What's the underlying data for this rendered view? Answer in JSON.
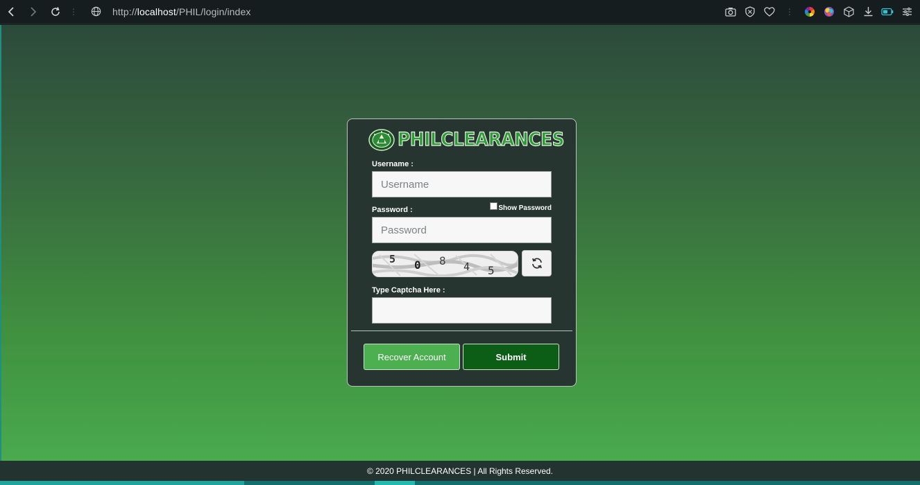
{
  "browser": {
    "url_host": "localhost",
    "url_prefix": "http://",
    "url_path": "/PHIL/login/index"
  },
  "brand": {
    "name": "PHILCLEARANCES"
  },
  "form": {
    "username_label": "Username :",
    "username_placeholder": "Username",
    "username_value": "",
    "password_label": "Password :",
    "password_placeholder": "Password",
    "password_value": "",
    "show_password_label": "Show Password",
    "show_password_checked": false,
    "captcha_digits": [
      "5",
      "0",
      "8",
      "4",
      "5"
    ],
    "captcha_label": "Type Captcha Here :",
    "captcha_value": ""
  },
  "buttons": {
    "recover_label": "Recover Account",
    "submit_label": "Submit"
  },
  "footer": {
    "text": "© 2020 PHILCLEARANCES | All Rights Reserved."
  },
  "colors": {
    "accent_green": "#4caf50",
    "dark_green": "#0c5d15",
    "card_bg": "#26352f"
  }
}
